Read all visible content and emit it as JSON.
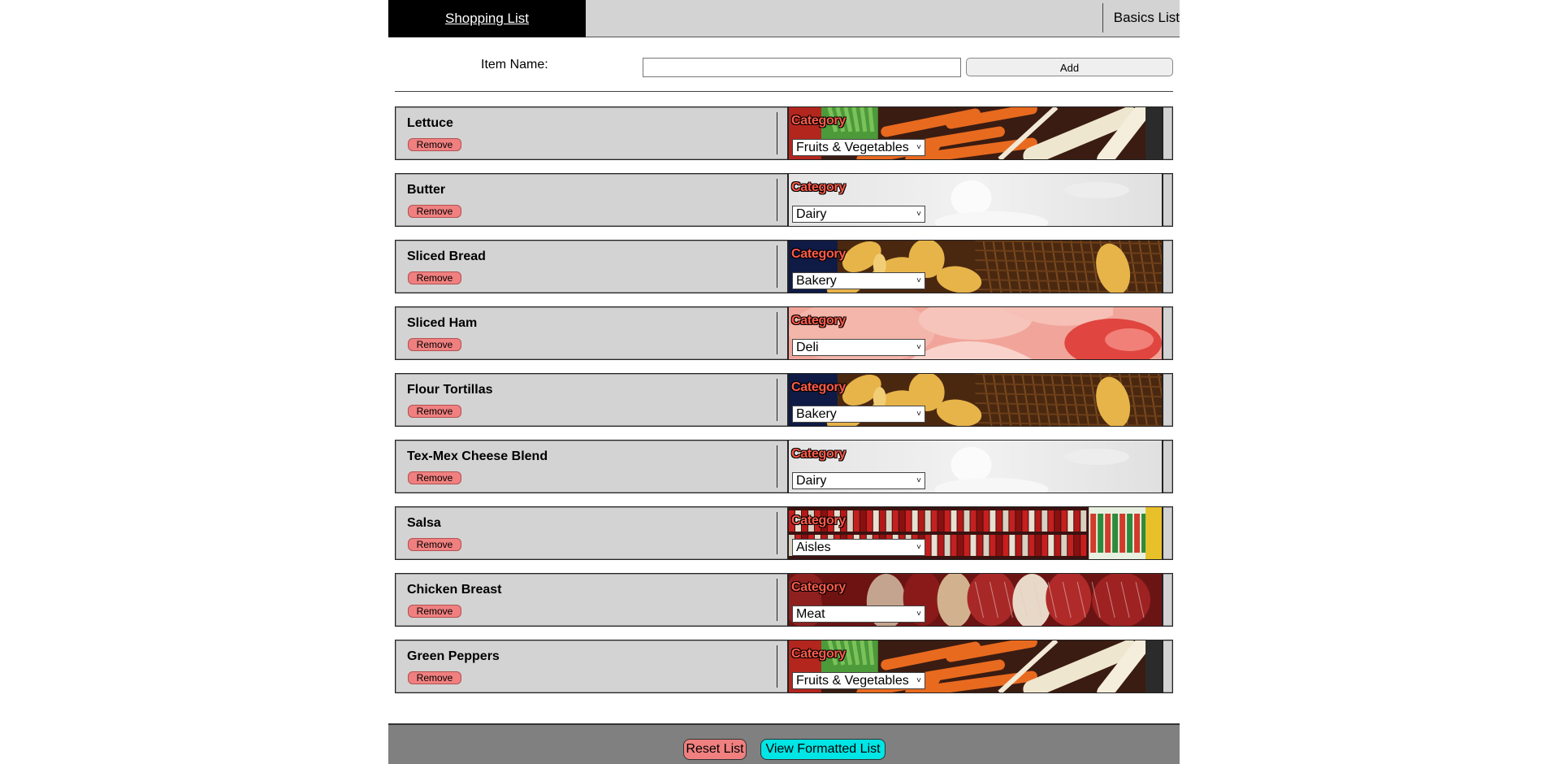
{
  "nav": {
    "active_tab": "Shopping List",
    "other_tab": "Basics List"
  },
  "form": {
    "item_name_label": "Item Name:",
    "item_name_value": "",
    "add_label": "Add"
  },
  "items": [
    {
      "name": "Lettuce",
      "remove_label": "Remove",
      "category_label": "Category",
      "category": "Fruits & Vegetables",
      "theme": "produce"
    },
    {
      "name": "Butter",
      "remove_label": "Remove",
      "category_label": "Category",
      "category": "Dairy",
      "theme": "dairy"
    },
    {
      "name": "Sliced Bread",
      "remove_label": "Remove",
      "category_label": "Category",
      "category": "Bakery",
      "theme": "bakery"
    },
    {
      "name": "Sliced Ham",
      "remove_label": "Remove",
      "category_label": "Category",
      "category": "Deli",
      "theme": "deli"
    },
    {
      "name": "Flour Tortillas",
      "remove_label": "Remove",
      "category_label": "Category",
      "category": "Bakery",
      "theme": "bakery"
    },
    {
      "name": "Tex-Mex Cheese Blend",
      "remove_label": "Remove",
      "category_label": "Category",
      "category": "Dairy",
      "theme": "dairy"
    },
    {
      "name": "Salsa",
      "remove_label": "Remove",
      "category_label": "Category",
      "category": "Aisles",
      "theme": "aisles"
    },
    {
      "name": "Chicken Breast",
      "remove_label": "Remove",
      "category_label": "Category",
      "category": "Meat",
      "theme": "meat"
    },
    {
      "name": "Green Peppers",
      "remove_label": "Remove",
      "category_label": "Category",
      "category": "Fruits & Vegetables",
      "theme": "produce"
    }
  ],
  "footer": {
    "reset_label": "Reset List",
    "view_label": "View Formatted List"
  },
  "colors": {
    "remove": "#f08080",
    "reset": "#f08080",
    "view": "#00e5e5",
    "category_text": "#ff5a4a"
  }
}
